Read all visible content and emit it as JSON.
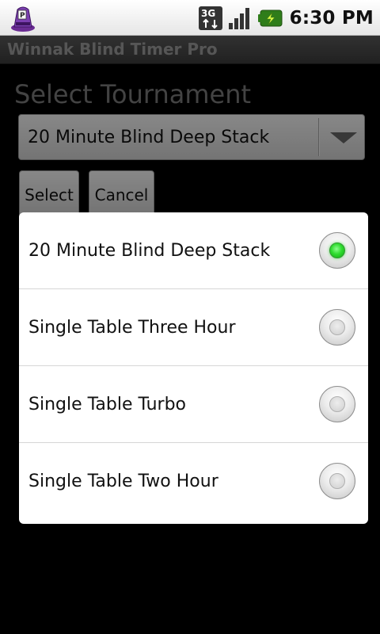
{
  "status_bar": {
    "time": "6:30 PM",
    "network_label": "3G",
    "icons": [
      "app-notification-icon",
      "3g-data-icon",
      "signal-strength-icon",
      "battery-charging-icon"
    ]
  },
  "app": {
    "title": "Winnak Blind Timer Pro"
  },
  "screen": {
    "heading": "Select Tournament",
    "spinner_value": "20 Minute Blind Deep Stack",
    "select_label": "Select",
    "cancel_label": "Cancel"
  },
  "dialog": {
    "options": [
      {
        "label": "20 Minute Blind Deep Stack",
        "selected": true
      },
      {
        "label": "Single Table Three Hour",
        "selected": false
      },
      {
        "label": "Single Table Turbo",
        "selected": false
      },
      {
        "label": "Single Table Two Hour",
        "selected": false
      }
    ]
  },
  "colors": {
    "status_bar_bg": "#ffffff",
    "title_bar_bg": "#4a4a4a",
    "radio_selected": "#22cc22",
    "dialog_bg": "#ffffff"
  }
}
